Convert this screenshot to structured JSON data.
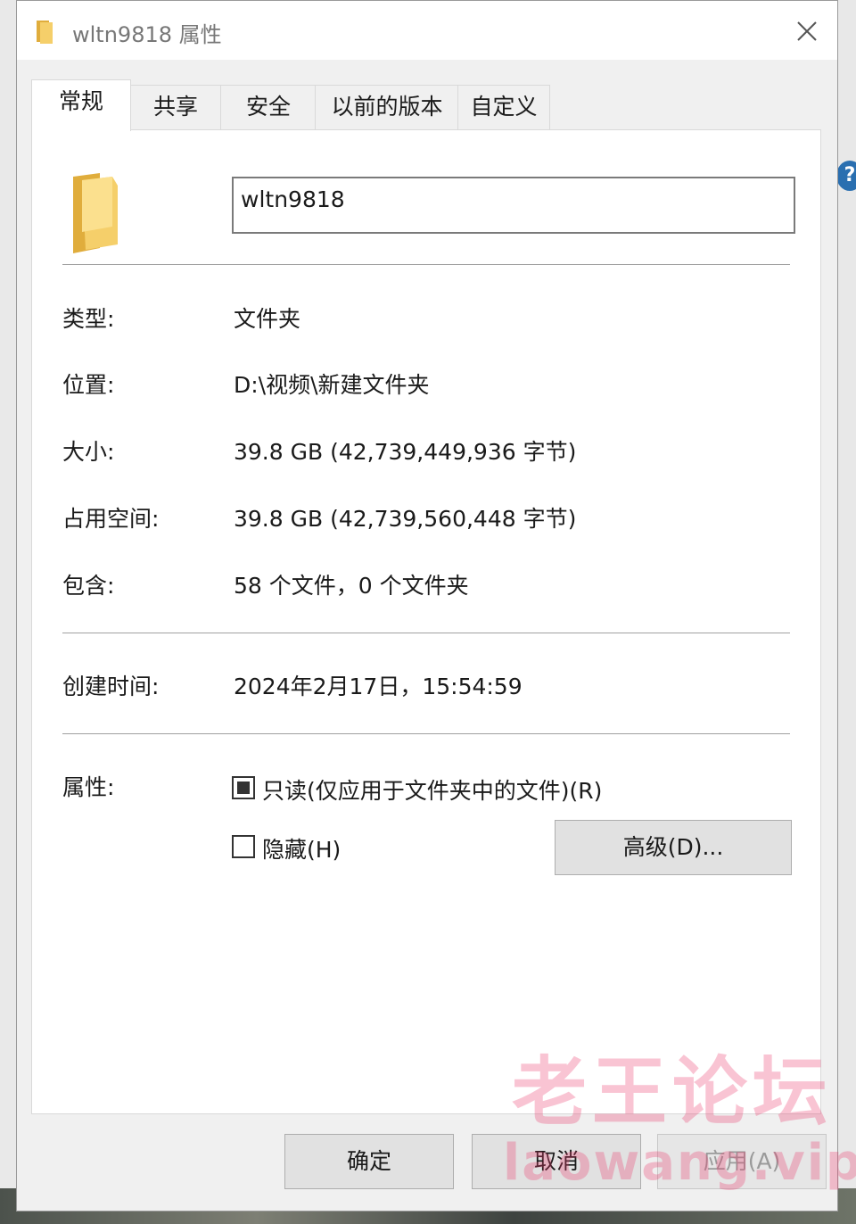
{
  "window": {
    "title": "wltn9818 属性"
  },
  "tabs": [
    {
      "label": "常规",
      "active": true
    },
    {
      "label": "共享",
      "active": false
    },
    {
      "label": "安全",
      "active": false
    },
    {
      "label": "以前的版本",
      "active": false
    },
    {
      "label": "自定义",
      "active": false
    }
  ],
  "general": {
    "name_value": "wltn9818",
    "type_label": "类型:",
    "type_value": "文件夹",
    "location_label": "位置:",
    "location_value": "D:\\视频\\新建文件夹",
    "size_label": "大小:",
    "size_value": "39.8 GB (42,739,449,936 字节)",
    "disk_size_label": "占用空间:",
    "disk_size_value": "39.8 GB (42,739,560,448 字节)",
    "contains_label": "包含:",
    "contains_value": "58 个文件，0 个文件夹",
    "created_label": "创建时间:",
    "created_value": "2024年2月17日，15:54:59",
    "attributes_label": "属性:",
    "readonly_label": "只读(仅应用于文件夹中的文件)(R)",
    "readonly_state": "indeterminate",
    "hidden_label": "隐藏(H)",
    "hidden_state": "unchecked",
    "advanced_label": "高级(D)..."
  },
  "footer": {
    "ok_label": "确定",
    "cancel_label": "取消",
    "apply_label": "应用(A)",
    "apply_enabled": false
  },
  "watermark": {
    "line1": "老王论坛",
    "line2": "laowang.vip"
  },
  "icons": {
    "title_icon": "folder-icon",
    "large_icon": "folder-icon",
    "close": "close-icon"
  },
  "colors": {
    "folder_yellow": "#f5cf6a",
    "folder_yellow_dark": "#e0ad3c",
    "watermark_pink": "#eb3c6e"
  }
}
